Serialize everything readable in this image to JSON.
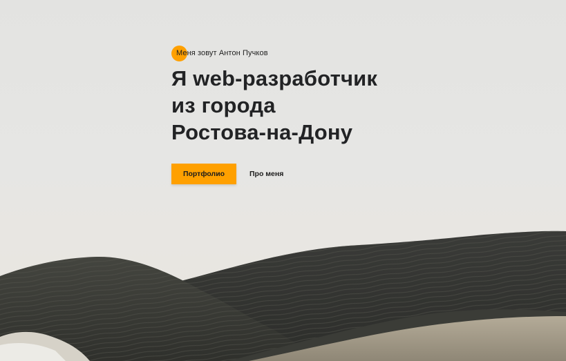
{
  "hero": {
    "intro": "Меня зовут Антон Пучков",
    "headline_bold": "Я web-",
    "headline_line1_rest": "разработчик",
    "headline_line2": "из города",
    "headline_line3": "Ростова-на-Дону"
  },
  "buttons": {
    "portfolio_label": "Портфолио",
    "about_label": "Про меня"
  },
  "colors": {
    "accent": "#ffa000",
    "text": "#222325",
    "sky": "#e4e4e2"
  }
}
